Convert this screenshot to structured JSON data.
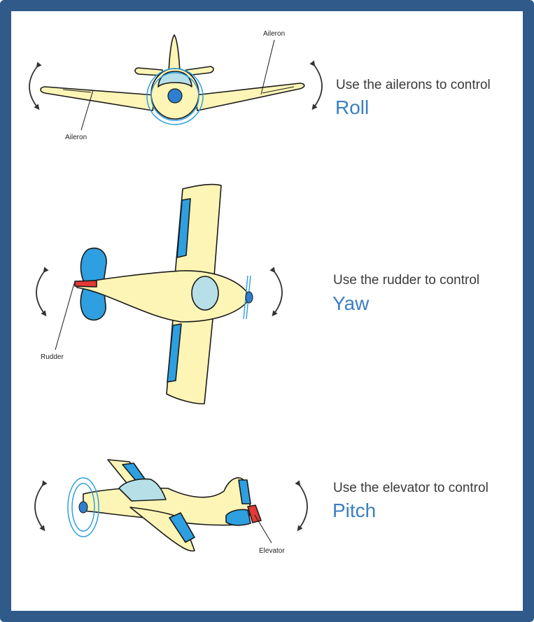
{
  "colors": {
    "frame": "#2f5a8a",
    "accent": "#3b7fc0",
    "body": "#fdf5b6",
    "control_surface": "#2e9fe0",
    "canopy": "#b6dfe8",
    "rudder_red": "#e53935",
    "outline": "#1a1a1a"
  },
  "sections": [
    {
      "caption": "Use the ailerons to control",
      "term": "Roll"
    },
    {
      "caption": "Use the rudder to control",
      "term": "Yaw"
    },
    {
      "caption": "Use the elevator to control",
      "term": "Pitch"
    }
  ],
  "labels": {
    "aileron_right": "Aileron",
    "aileron_left": "Aileron",
    "rudder": "Rudder",
    "elevator": "Elevator"
  },
  "icons": [
    "rotation-arrow-icon"
  ]
}
